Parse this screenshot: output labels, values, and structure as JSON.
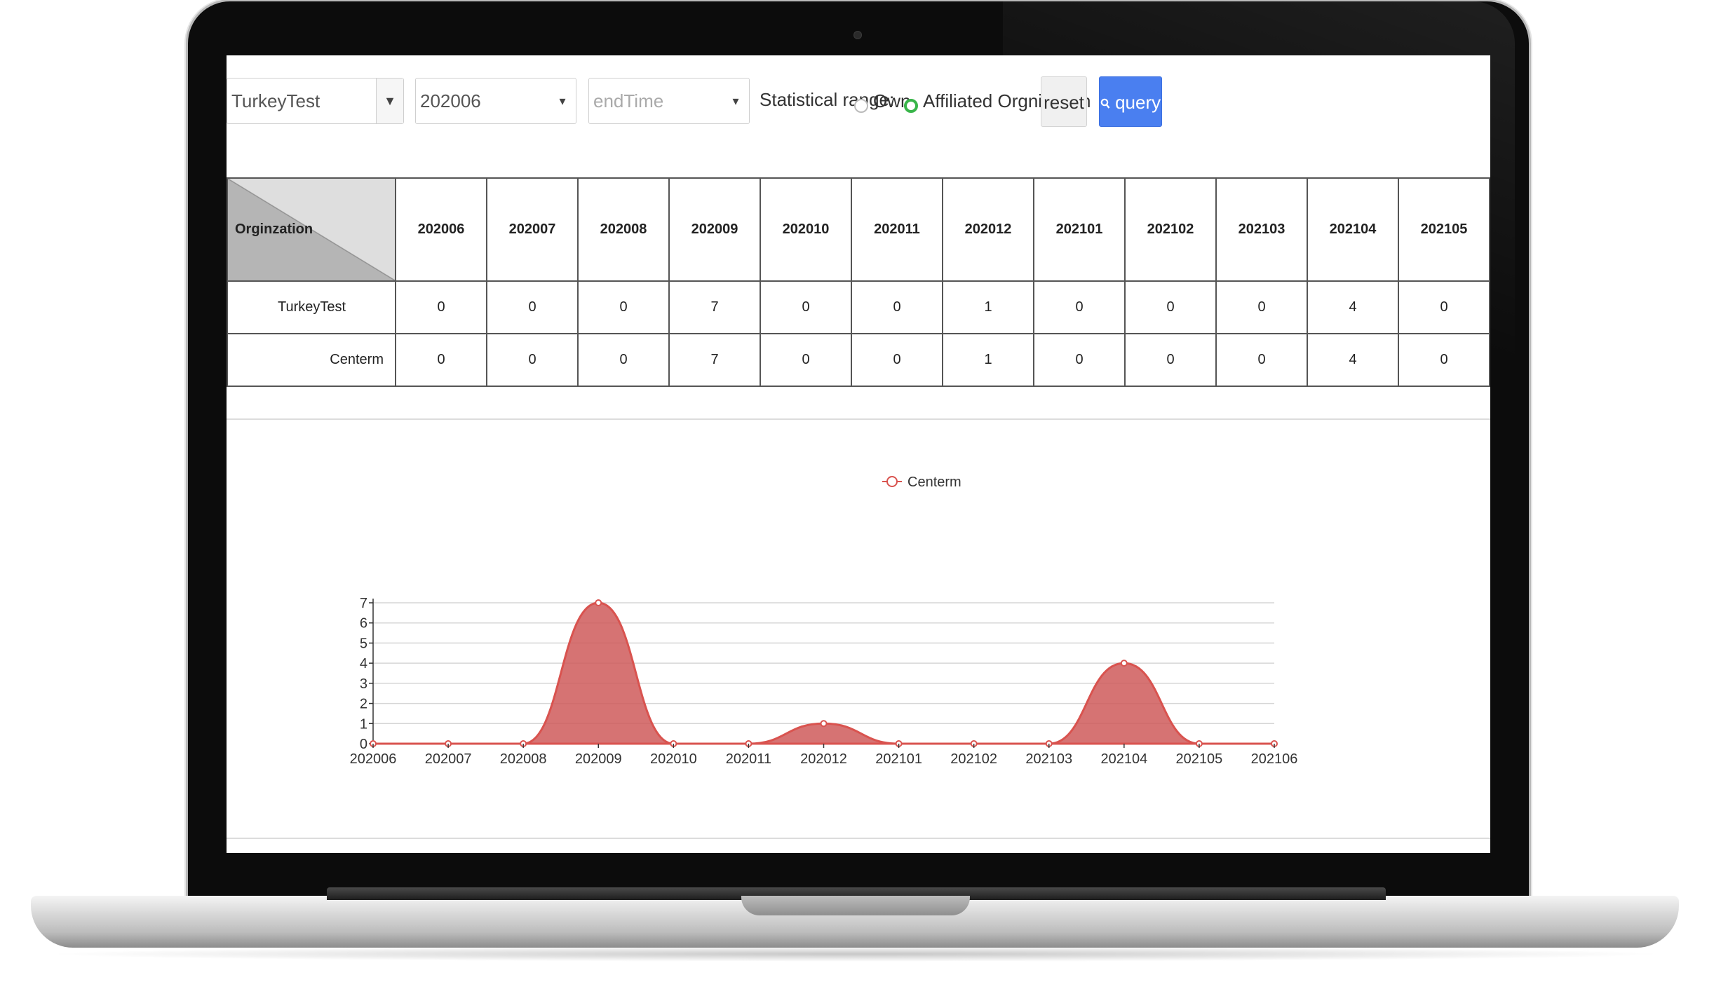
{
  "toolbar": {
    "organization_value": "TurkeyTest",
    "organization_arrow": "▼",
    "start_value": "202006",
    "end_placeholder": "endTime",
    "select_arrow": "▾",
    "statistical_range_label": "Statistical range:",
    "radio_own_label": "Own",
    "radio_affiliated_label": "Affiliated Orgnization",
    "radio_selected": "affiliated",
    "reset_label": "reset",
    "query_label": "query",
    "query_icon": "search-icon"
  },
  "table": {
    "corner_label": "Orginzation",
    "columns": [
      "202006",
      "202007",
      "202008",
      "202009",
      "202010",
      "202011",
      "202012",
      "202101",
      "202102",
      "202103",
      "202104",
      "202105"
    ],
    "rows": [
      {
        "name": "TurkeyTest",
        "values": [
          "0",
          "0",
          "0",
          "7",
          "0",
          "0",
          "1",
          "0",
          "0",
          "0",
          "4",
          "0"
        ]
      },
      {
        "name": "Centerm",
        "values": [
          "0",
          "0",
          "0",
          "7",
          "0",
          "0",
          "1",
          "0",
          "0",
          "0",
          "4",
          "0"
        ]
      }
    ]
  },
  "colors": {
    "series": "#d9534f",
    "series_fill": "#cf5a5a",
    "query_button": "#4a7ff0",
    "radio_checked": "#39b54a"
  },
  "chart_data": {
    "type": "area",
    "legend": [
      "Centerm"
    ],
    "legend_position": "top-center",
    "categories": [
      "202006",
      "202007",
      "202008",
      "202009",
      "202010",
      "202011",
      "202012",
      "202101",
      "202102",
      "202103",
      "202104",
      "202105",
      "202106"
    ],
    "series": [
      {
        "name": "Centerm",
        "values": [
          0,
          0,
          0,
          7,
          0,
          0,
          1,
          0,
          0,
          0,
          4,
          0,
          0
        ]
      }
    ],
    "ylim": [
      0,
      7
    ],
    "yticks": [
      0,
      1,
      2,
      3,
      4,
      5,
      6,
      7
    ],
    "grid": true,
    "smooth": true
  }
}
